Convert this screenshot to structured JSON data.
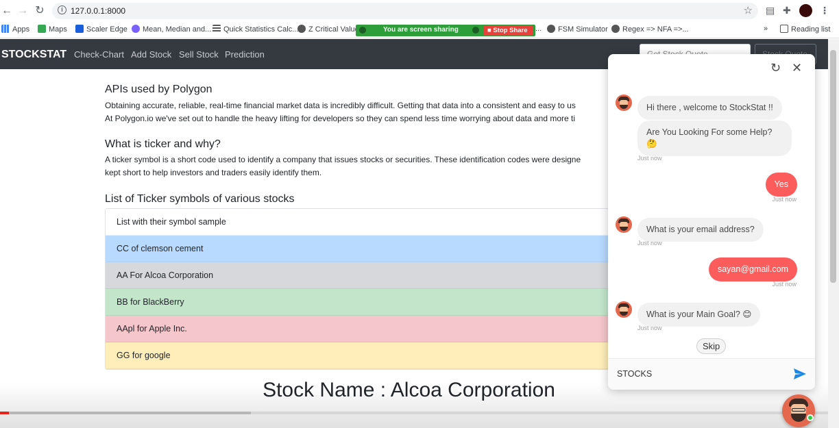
{
  "browser": {
    "url": "127.0.0.1:8000",
    "bookmarks": [
      {
        "label": "Apps"
      },
      {
        "label": "Maps"
      },
      {
        "label": "Scaler Edge"
      },
      {
        "label": "Mean, Median and..."
      },
      {
        "label": "Quick Statistics Calc..."
      },
      {
        "label": "Z Critical Value"
      },
      {
        "label": "..."
      },
      {
        "label": "FSM Simulator"
      },
      {
        "label": "Regex => NFA =>..."
      }
    ],
    "more": "»",
    "reading_list": "Reading list"
  },
  "share_banner": {
    "text": "You are screen sharing",
    "stop_label": "Stop Share"
  },
  "navbar": {
    "brand": "STOCKSTAT",
    "links": [
      "Check-Chart",
      "Add Stock",
      "Sell Stock",
      "Prediction"
    ],
    "search_text": "Get Stock Quote",
    "button_text": "Stock Quote"
  },
  "content": {
    "apis_heading": "APIs used by Polygon",
    "apis_line1": "Obtaining accurate, reliable, real-time financial market data is incredibly difficult. Getting that data into a consistent and easy to us",
    "apis_line2": "At Polygon.io we've set out to handle the heavy lifting for developers so they can spend less time worrying about data and more ti",
    "ticker_heading": "What is ticker and why?",
    "ticker_line1": "A ticker symbol is a short code used to identify a company that issues stocks or securities. These identification codes were designe",
    "ticker_line2": "kept short to help investors and traders easily identify them.",
    "list_heading": "List of Ticker symbols of various stocks",
    "list_items": [
      {
        "text": "List with their symbol sample",
        "color": "#ffffff"
      },
      {
        "text": "CC of clemson cement",
        "color": "#b8daff"
      },
      {
        "text": "AA For Alcoa Corporation",
        "color": "#d6d8db"
      },
      {
        "text": "BB for BlackBerry",
        "color": "#c3e6cb"
      },
      {
        "text": "AApl for Apple Inc.",
        "color": "#f5c6cb"
      },
      {
        "text": "GG for google",
        "color": "#ffeeba"
      }
    ],
    "stock_title": "Stock Name : Alcoa Corporation"
  },
  "chat": {
    "messages": [
      {
        "from": "bot",
        "text": "Hi there , welcome to StockStat !!"
      },
      {
        "from": "bot",
        "text": "Are You Looking For some Help?",
        "emoji": "🤔",
        "time": "Just now"
      },
      {
        "from": "user",
        "text": "Yes",
        "time": "Just now"
      },
      {
        "from": "bot",
        "text": "What is your email address?",
        "time": "Just now"
      },
      {
        "from": "user",
        "text": "sayan@gmail.com",
        "time": "Just now"
      },
      {
        "from": "bot",
        "text": "What is your Main Goal? 😊",
        "time": "Just now"
      }
    ],
    "skip_label": "Skip",
    "input_value": "STOCKS",
    "accent": "#fc5c5c"
  }
}
